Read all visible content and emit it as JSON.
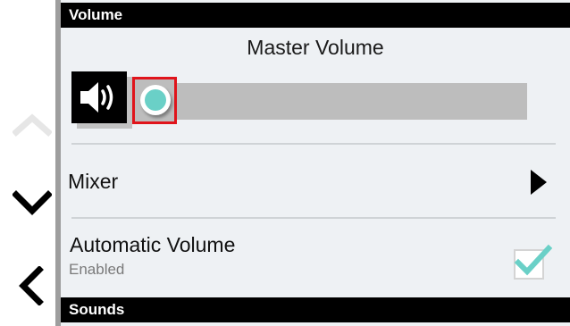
{
  "nav": {
    "up_icon": "chevron-up-icon",
    "down_icon": "chevron-down-icon",
    "back_icon": "chevron-left-icon",
    "up_color": "#e6e6e6",
    "down_color": "#000000",
    "back_color": "#000000"
  },
  "sections": {
    "volume_title": "Volume",
    "sounds_title": "Sounds"
  },
  "master_volume": {
    "title": "Master Volume",
    "icon": "speaker-icon",
    "level_fraction": 0.0,
    "thumb_color": "#6ad0c7",
    "track_color": "#bdbdbd",
    "highlight_color": "#e0141b"
  },
  "mixer": {
    "label": "Mixer",
    "icon": "chevron-right-icon"
  },
  "automatic_volume": {
    "label": "Automatic Volume",
    "status": "Enabled",
    "checked": true,
    "check_color": "#6ad0c7"
  }
}
